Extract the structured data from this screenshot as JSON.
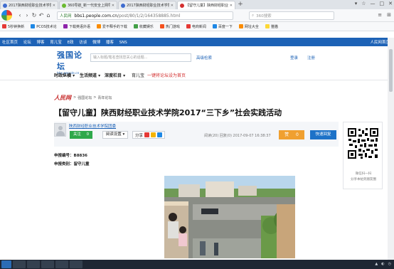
{
  "browser": {
    "tabs": [
      {
        "label": "2017陕西财经职业技术学院…",
        "color": "#3f6ccf",
        "active": false
      },
      {
        "label": "360导航_新一代安全上网导航",
        "color": "#6aba2f",
        "active": false
      },
      {
        "label": "2017陕西财经职业技术学院…",
        "color": "#3f6ccf",
        "active": false
      },
      {
        "label": "【留守儿童】陕西财经职业…",
        "color": "#d32f2f",
        "active": true
      }
    ],
    "new_tab_symbol": "+",
    "window_controls": [
      "▾",
      "☆",
      "—",
      "□",
      "✕"
    ],
    "url_secure_label": "人民网",
    "url_host": "bbs1.people.com.cn",
    "url_path": "/post/80/1/2/164358885.html",
    "search_placeholder": "360搜索",
    "bookmarks": [
      {
        "label": "5秒钟换新",
        "color": "#e53935"
      },
      {
        "label": "PCOS技术论",
        "color": "#1e88e5"
      },
      {
        "label": "下载英语外语",
        "color": "#8e24aa"
      },
      {
        "label": "爱不释手的下载",
        "color": "#fb8c00"
      },
      {
        "label": "收藏娱乐",
        "color": "#43a047"
      },
      {
        "label": "热门游戏",
        "color": "#f4511e"
      },
      {
        "label": "电商新闻",
        "color": "#e53935"
      },
      {
        "label": "百度一下",
        "color": "#1e88e5"
      },
      {
        "label": "网址大全",
        "color": "#fb8c00"
      },
      {
        "label": "猫猫",
        "color": "#fdd835"
      }
    ]
  },
  "site": {
    "topbar_links": [
      "社区首页",
      "论坛",
      "博客",
      "育儿宝",
      "E政",
      "访谈",
      "微博",
      "播客",
      "SNS"
    ],
    "topbar_right": "人民网首页",
    "logo_main": "强国论坛",
    "logo_sub": "bbs.people.cn",
    "search_placeholder": "输入标题/笔名查找您关心的话题...",
    "adv_search": "高级检索",
    "login": "登录",
    "register": "注册",
    "nav": [
      "时政纵横 ▾",
      "生活频道 ▾",
      "深度栏目 ▾",
      "育儿宝"
    ],
    "nav_promo": "一键将论坛设为首页"
  },
  "breadcrumb": {
    "logo": "人民网",
    "items": [
      "强国论坛",
      "青年论坛"
    ],
    "separator": ">"
  },
  "post": {
    "title": "【留守儿童】陕西财经职业技术学院2017“三下乡”社会实践活动",
    "author": "陕西财经职业技术学院团委",
    "follow": "关注",
    "follow_count": "0",
    "view_settings": "阅读设置 ▾",
    "share": "分享",
    "stats": "阅读(20) 回复(0)  2017-09-07 16:38:37",
    "like": "赞",
    "like_count": "0",
    "quick_reply": "快速回复",
    "apply_no": "申报编号：B8836",
    "apply_type": "申报类别：留守儿童"
  },
  "qr": {
    "caption1": "微信扫一扫",
    "caption2": "分享本帖到朋友圈"
  },
  "colors": {
    "brand_blue": "#1d62b6",
    "follow_green": "#2ea84a",
    "like_orange": "#f0a030",
    "reply_blue": "#1d72c8"
  }
}
